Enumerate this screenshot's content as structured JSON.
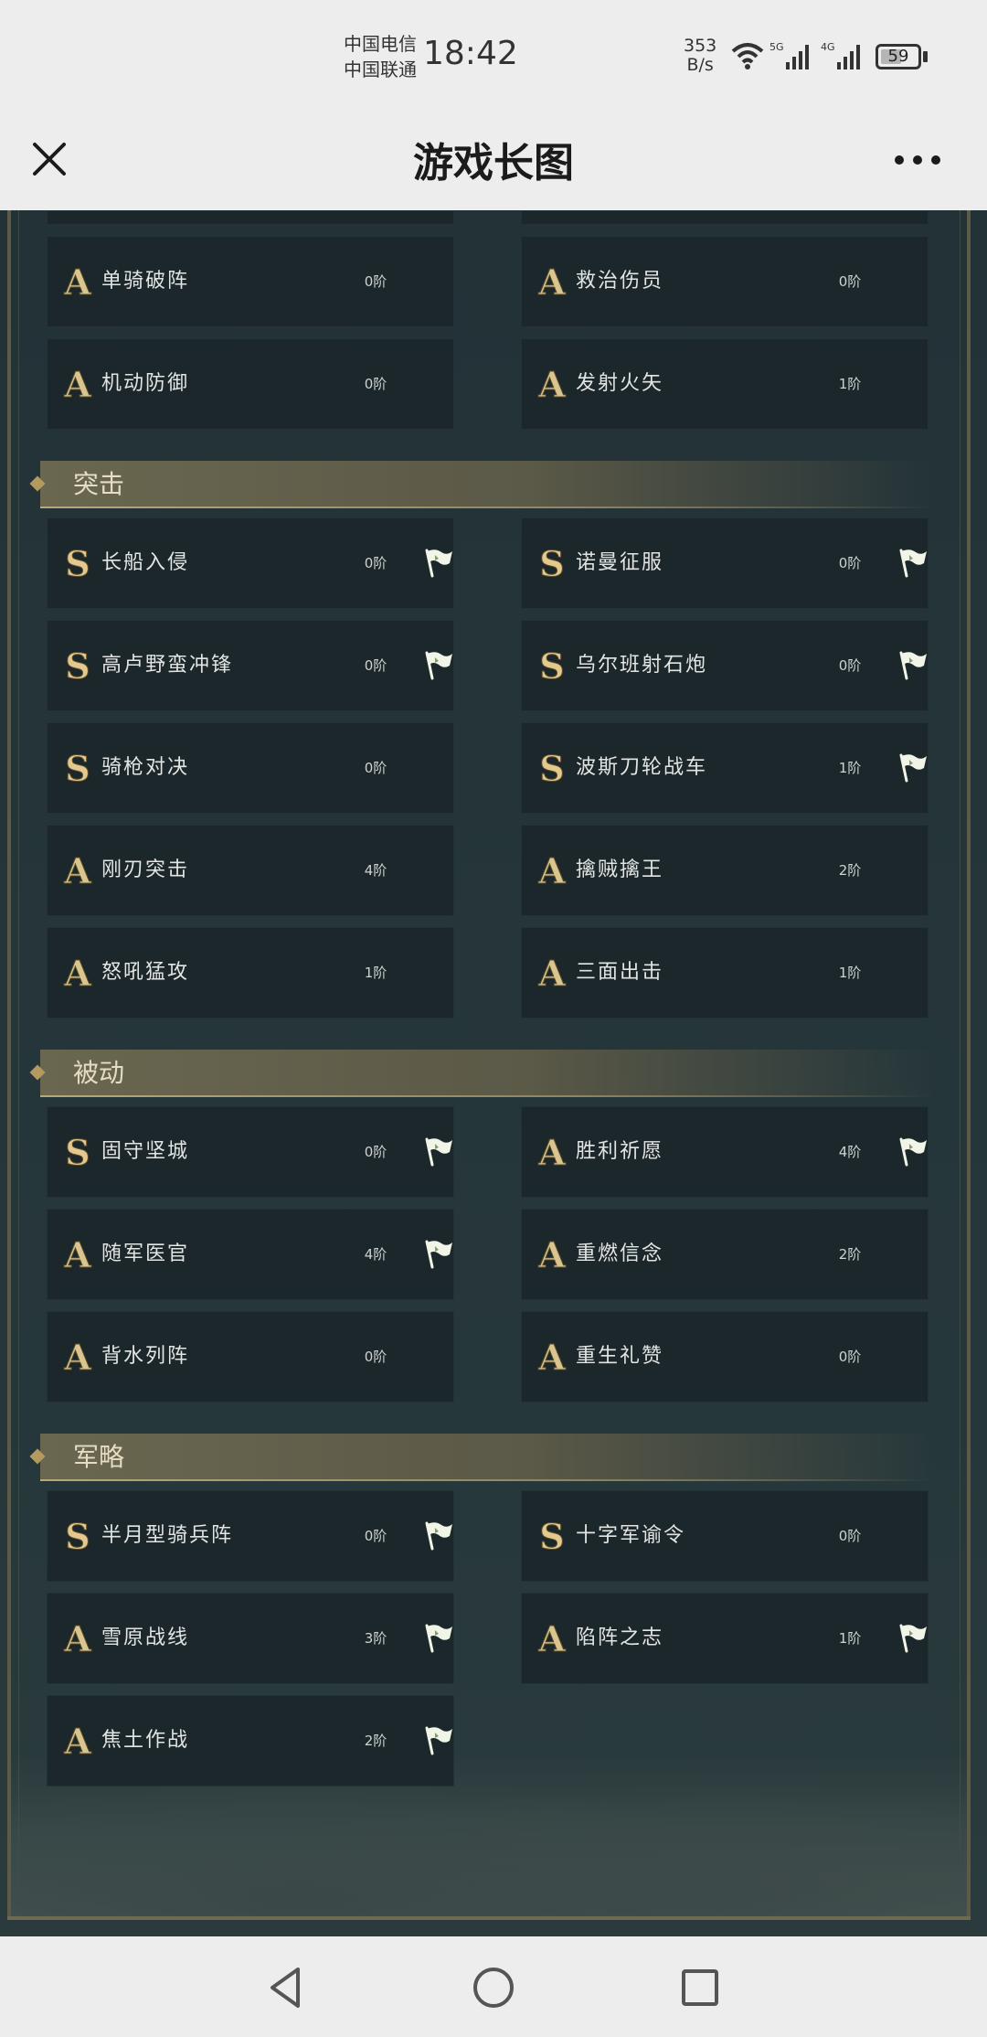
{
  "status_bar": {
    "carrier_1": "中国电信",
    "carrier_2": "中国联通",
    "time": "18:42",
    "net_speed_value": "353",
    "net_speed_unit": "B/s",
    "network_1": "5G",
    "network_2": "4G",
    "battery": "59",
    "battery_level": 0.59
  },
  "title_bar": {
    "title": "游戏长图"
  },
  "colors": {
    "grade_s": "#e3c88f",
    "grade_a": "#d9c58f",
    "flag": "#f1f5e8",
    "section_title": "#e5dcc2"
  },
  "top_rows": [
    {
      "left": {
        "grade": "A",
        "name": "单骑破阵",
        "level": "0阶",
        "flag": false
      },
      "right": {
        "grade": "A",
        "name": "救治伤员",
        "level": "0阶",
        "flag": false
      }
    },
    {
      "left": {
        "grade": "A",
        "name": "机动防御",
        "level": "0阶",
        "flag": false
      },
      "right": {
        "grade": "A",
        "name": "发射火矢",
        "level": "1阶",
        "flag": false
      }
    }
  ],
  "sections": [
    {
      "title": "突击",
      "rows": [
        {
          "left": {
            "grade": "S",
            "name": "长船入侵",
            "level": "0阶",
            "flag": true
          },
          "right": {
            "grade": "S",
            "name": "诺曼征服",
            "level": "0阶",
            "flag": true
          }
        },
        {
          "left": {
            "grade": "S",
            "name": "高卢野蛮冲锋",
            "level": "0阶",
            "flag": true
          },
          "right": {
            "grade": "S",
            "name": "乌尔班射石炮",
            "level": "0阶",
            "flag": true
          }
        },
        {
          "left": {
            "grade": "S",
            "name": "骑枪对决",
            "level": "0阶",
            "flag": false
          },
          "right": {
            "grade": "S",
            "name": "波斯刀轮战车",
            "level": "1阶",
            "flag": true
          }
        },
        {
          "left": {
            "grade": "A",
            "name": "刚刃突击",
            "level": "4阶",
            "flag": false
          },
          "right": {
            "grade": "A",
            "name": "擒贼擒王",
            "level": "2阶",
            "flag": false
          }
        },
        {
          "left": {
            "grade": "A",
            "name": "怒吼猛攻",
            "level": "1阶",
            "flag": false
          },
          "right": {
            "grade": "A",
            "name": "三面出击",
            "level": "1阶",
            "flag": false
          }
        }
      ]
    },
    {
      "title": "被动",
      "rows": [
        {
          "left": {
            "grade": "S",
            "name": "固守坚城",
            "level": "0阶",
            "flag": true
          },
          "right": {
            "grade": "A",
            "name": "胜利祈愿",
            "level": "4阶",
            "flag": true
          }
        },
        {
          "left": {
            "grade": "A",
            "name": "随军医官",
            "level": "4阶",
            "flag": true
          },
          "right": {
            "grade": "A",
            "name": "重燃信念",
            "level": "2阶",
            "flag": false
          }
        },
        {
          "left": {
            "grade": "A",
            "name": "背水列阵",
            "level": "0阶",
            "flag": false
          },
          "right": {
            "grade": "A",
            "name": "重生礼赞",
            "level": "0阶",
            "flag": false
          }
        }
      ]
    },
    {
      "title": "军略",
      "rows": [
        {
          "left": {
            "grade": "S",
            "name": "半月型骑兵阵",
            "level": "0阶",
            "flag": true
          },
          "right": {
            "grade": "S",
            "name": "十字军谕令",
            "level": "0阶",
            "flag": false
          }
        },
        {
          "left": {
            "grade": "A",
            "name": "雪原战线",
            "level": "3阶",
            "flag": true
          },
          "right": {
            "grade": "A",
            "name": "陷阵之志",
            "level": "1阶",
            "flag": true
          }
        },
        {
          "left": {
            "grade": "A",
            "name": "焦土作战",
            "level": "2阶",
            "flag": true
          }
        }
      ]
    }
  ],
  "nav_bar": {
    "back_icon": "triangle-back-icon",
    "home_icon": "circle-home-icon",
    "recents_icon": "square-recents-icon"
  }
}
